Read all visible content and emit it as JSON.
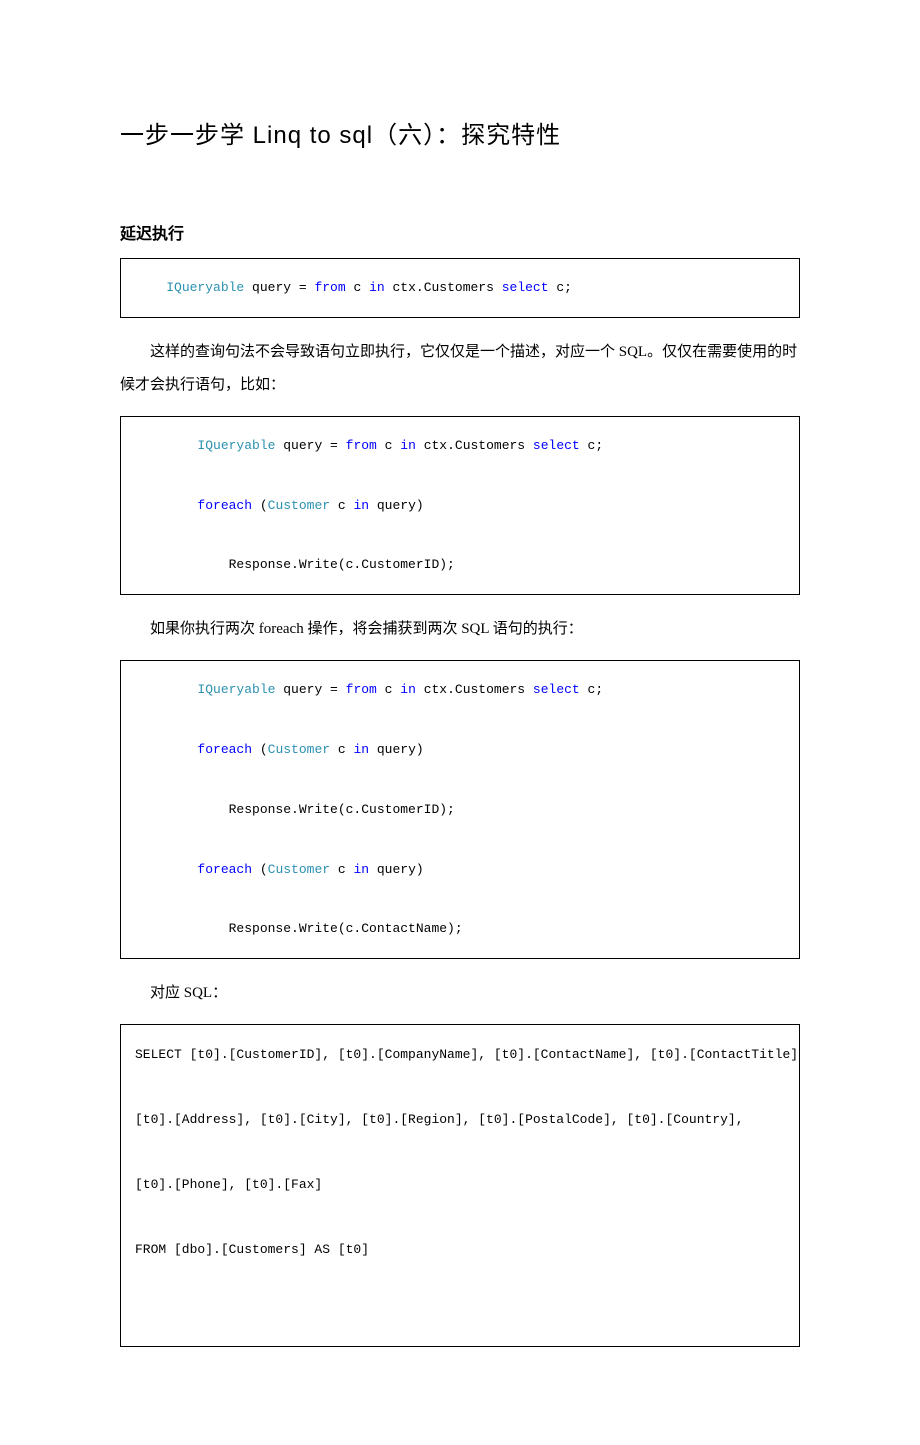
{
  "title": "一步一步学 Linq to sql（六）：探究特性",
  "section1_heading": "延迟执行",
  "para1": "这样的查询句法不会导致语句立即执行，它仅仅是一个描述，对应一个 SQL。仅仅在需要使用的时候才会执行语句，比如：",
  "para2": "如果你执行两次 foreach 操作，将会捕获到两次 SQL 语句的执行：",
  "para3": "对应 SQL：",
  "code1": {
    "t_IQueryable": "IQueryable",
    "t_query": " query = ",
    "t_from": "from",
    "t_c_in": " c ",
    "t_in": "in",
    "t_ctx": " ctx.Customers ",
    "t_select": "select",
    "t_c_end": " c;"
  },
  "code2": {
    "l1_IQ": "IQueryable",
    "l1_q": " query = ",
    "l1_from": "from",
    "l1_cin": " c ",
    "l1_in": "in",
    "l1_ctx": " ctx.Customers ",
    "l1_select": "select",
    "l1_cend": " c;",
    "l2_foreach": "foreach",
    "l2_sp": " (",
    "l2_Customer": "Customer",
    "l2_cin": " c ",
    "l2_in": "in",
    "l2_q": " query)",
    "l3": "            Response.Write(c.CustomerID);"
  },
  "code3": {
    "l1_IQ": "IQueryable",
    "l1_q": " query = ",
    "l1_from": "from",
    "l1_cin": " c ",
    "l1_in": "in",
    "l1_ctx": " ctx.Customers ",
    "l1_select": "select",
    "l1_cend": " c;",
    "l2_foreach": "foreach",
    "l2_sp": " (",
    "l2_Customer": "Customer",
    "l2_cin": " c ",
    "l2_in": "in",
    "l2_q": " query)",
    "l3": "            Response.Write(c.CustomerID);",
    "l4_foreach": "foreach",
    "l4_sp": " (",
    "l4_Customer": "Customer",
    "l4_cin": " c ",
    "l4_in": "in",
    "l4_q": " query)",
    "l5": "            Response.Write(c.ContactName);"
  },
  "code4": {
    "l1": "SELECT [t0].[CustomerID], [t0].[CompanyName], [t0].[ContactName], [t0].[ContactTitle],",
    "l2": "[t0].[Address], [t0].[City], [t0].[Region], [t0].[PostalCode], [t0].[Country],",
    "l3": "[t0].[Phone], [t0].[Fax]",
    "l4": "FROM [dbo].[Customers] AS [t0]"
  }
}
